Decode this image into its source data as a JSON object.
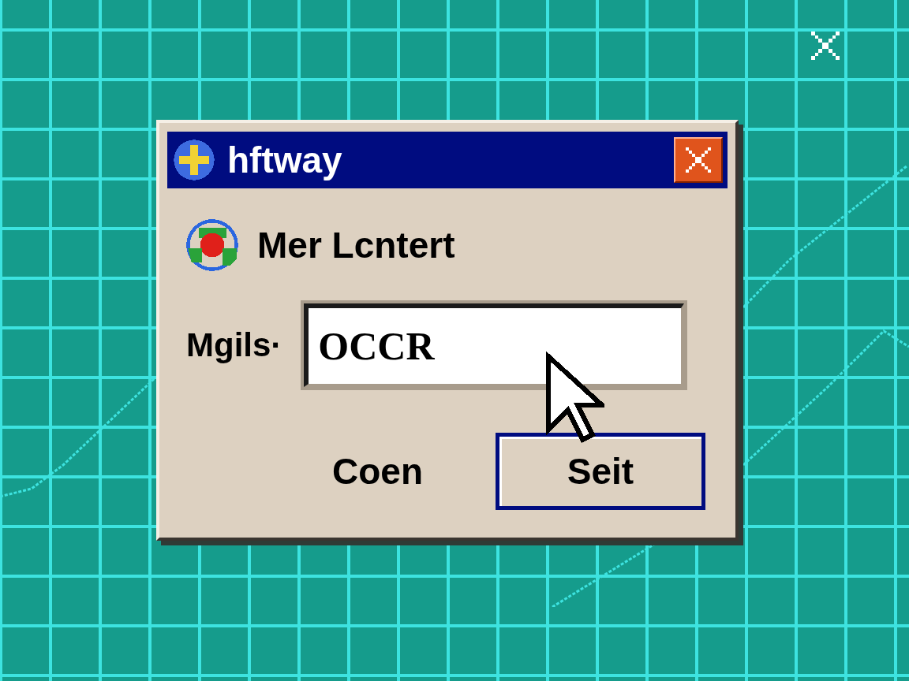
{
  "window": {
    "title": "hftway"
  },
  "message": {
    "text": "Mer Lcntert"
  },
  "field": {
    "label": "Mgils·",
    "value": "OCCR"
  },
  "buttons": [
    {
      "label": "Coen",
      "default": false
    },
    {
      "label": "Seit",
      "default": true
    }
  ]
}
